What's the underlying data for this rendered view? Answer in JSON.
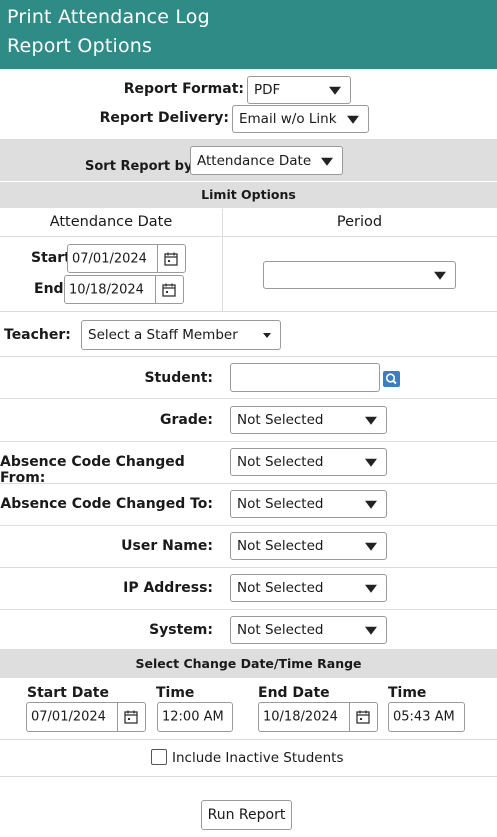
{
  "header": {
    "line1": "Print Attendance Log",
    "line2": "Report Options"
  },
  "report_format": {
    "label": "Report Format:",
    "value": "PDF"
  },
  "report_delivery": {
    "label": "Report Delivery:",
    "value": "Email w/o Link"
  },
  "sort": {
    "label": "Sort Report by:",
    "value": "Attendance Date"
  },
  "limit_options": {
    "title": "Limit Options"
  },
  "attendance_date": {
    "header": "Attendance Date",
    "start_label": "Start:",
    "start_value": "07/01/2024",
    "end_label": "End:",
    "end_value": "10/18/2024"
  },
  "period": {
    "header": "Period",
    "value": ""
  },
  "teacher": {
    "label": "Teacher:",
    "value": "Select a Staff Member"
  },
  "student": {
    "label": "Student:",
    "value": ""
  },
  "filters": [
    {
      "label": "Grade:",
      "value": "Not Selected"
    },
    {
      "label": "Absence Code Changed From:",
      "value": "Not Selected"
    },
    {
      "label": "Absence Code Changed To:",
      "value": "Not Selected"
    },
    {
      "label": "User Name:",
      "value": "Not Selected"
    },
    {
      "label": "IP Address:",
      "value": "Not Selected"
    },
    {
      "label": "System:",
      "value": "Not Selected"
    }
  ],
  "change_range": {
    "title": "Select Change Date/Time Range",
    "start_date_label": "Start Date",
    "start_date": "07/01/2024",
    "start_time_label": "Time",
    "start_time": "12:00 AM",
    "end_date_label": "End Date",
    "end_date": "10/18/2024",
    "end_time_label": "Time",
    "end_time": "05:43 AM"
  },
  "inactive": {
    "label": "Include Inactive Students",
    "checked": false
  },
  "run_button": "Run Report",
  "colors": {
    "header": "#2e8b86",
    "band": "#dedede",
    "search_icon": "#3a7fc1"
  }
}
